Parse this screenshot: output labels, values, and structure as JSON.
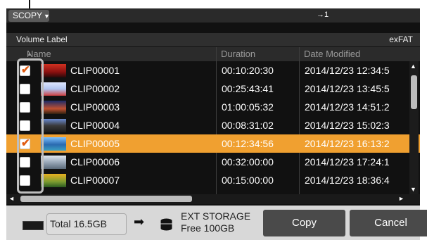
{
  "toolbar": {
    "mode_label": "SCOPY",
    "mode_caret": "▼",
    "copy_counter": "→1"
  },
  "volume": {
    "label": "Volume Label",
    "filesystem": "exFAT"
  },
  "columns": {
    "name": "Name",
    "sort_arrow": "▲",
    "duration": "Duration",
    "date_modified": "Date Modified"
  },
  "clips": [
    {
      "checked": true,
      "selected": false,
      "name": "CLIP00001",
      "duration": "00:10:20:30",
      "date_modified": "2014/12/23 12:34:5"
    },
    {
      "checked": false,
      "selected": false,
      "name": "CLIP00002",
      "duration": "00:25:43:41",
      "date_modified": "2014/12/23 13:45:5"
    },
    {
      "checked": false,
      "selected": false,
      "name": "CLIP00003",
      "duration": "01:00:05:32",
      "date_modified": "2014/12/23 14:51:2"
    },
    {
      "checked": false,
      "selected": false,
      "name": "CLIP00004",
      "duration": "00:08:31:02",
      "date_modified": "2014/12/23 15:02:3"
    },
    {
      "checked": true,
      "selected": true,
      "name": "CLIP00005",
      "duration": "00:12:34:56",
      "date_modified": "2014/12/23 16:13:2"
    },
    {
      "checked": false,
      "selected": false,
      "name": "CLIP00006",
      "duration": "00:32:00:00",
      "date_modified": "2014/12/23 17:24:1"
    },
    {
      "checked": false,
      "selected": false,
      "name": "CLIP00007",
      "duration": "00:15:00:00",
      "date_modified": "2014/12/23 18:36:4"
    }
  ],
  "source": {
    "total": "Total 16.5GB"
  },
  "destination": {
    "name": "EXT STORAGE",
    "free": "Free 100GB"
  },
  "buttons": {
    "copy": "Copy",
    "cancel": "Cancel"
  },
  "icons": {
    "check": "✔",
    "up": "▲",
    "down": "▼",
    "left": "◄",
    "right": "►",
    "arrow": "➡"
  },
  "colors": {
    "selected_row": "#f0a030",
    "check_mark": "#e05a10"
  }
}
